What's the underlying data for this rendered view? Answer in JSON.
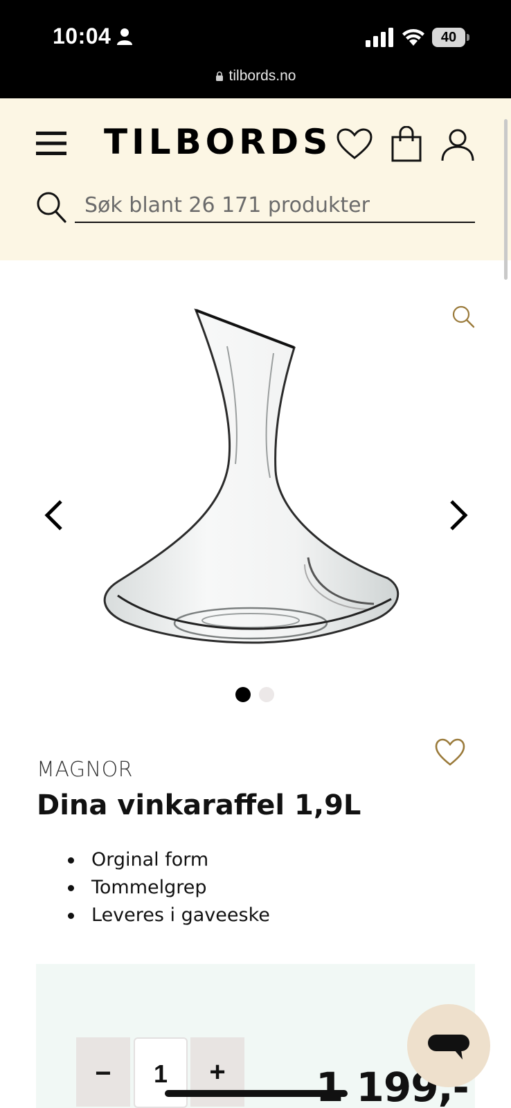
{
  "status_bar": {
    "time": "10:04",
    "battery": "40",
    "url": "tilbords.no"
  },
  "header": {
    "logo": "TILBORDS",
    "search": {
      "placeholder": "Søk blant 26 171 produkter",
      "value": ""
    }
  },
  "gallery": {
    "image": "decanter",
    "slide_count": 2,
    "active_slide": 1
  },
  "product": {
    "brand": "MAGNOR",
    "title": "Dina vinkaraffel 1,9L",
    "features": [
      "Orginal form",
      "Tommelgrep",
      "Leveres i gaveeske"
    ]
  },
  "purchase": {
    "minus": "−",
    "plus": "+",
    "quantity": "1",
    "price": "1 199,-"
  },
  "colors": {
    "header_bg": "#fcf6e4",
    "buybox_bg": "#f1f8f5",
    "accent": "#9a7a3a",
    "chat_bg": "#eee0cc"
  },
  "icons": [
    "person-icon",
    "signal-icon",
    "wifi-icon",
    "lock-icon",
    "menu-icon",
    "heart-icon",
    "bag-icon",
    "user-icon",
    "search-icon",
    "zoom-icon",
    "chevron-left-icon",
    "chevron-right-icon",
    "chat-icon"
  ]
}
